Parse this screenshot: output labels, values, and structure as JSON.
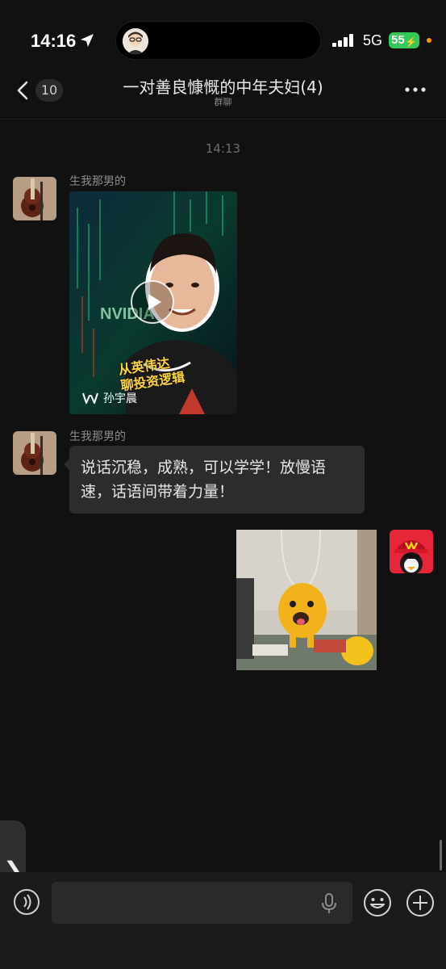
{
  "status_bar": {
    "time": "14:16",
    "network": "5G",
    "battery": "55"
  },
  "nav": {
    "unread_count": "10",
    "title": "一对善良慷慨的中年夫妇(4)",
    "subtitle": "群聊"
  },
  "chat": {
    "timestamp": "14:13",
    "messages": [
      {
        "sender": "生我那男的",
        "type": "video",
        "video_caption_line1": "从英伟达",
        "video_caption_line2": "聊投资逻辑",
        "video_source": "孙宇晨"
      },
      {
        "sender": "生我那男的",
        "type": "text",
        "text": "说话沉稳，成熟，可以学学！放慢语速，话语间带着力量！"
      },
      {
        "sender": "me",
        "type": "image"
      }
    ]
  },
  "side_tab": {
    "label": "❯"
  },
  "input_bar": {
    "value": "",
    "placeholder": ""
  },
  "colors": {
    "background": "#111111",
    "bubble": "#2c2c2c",
    "battery": "#34c759",
    "caption": "#ffd43b"
  }
}
